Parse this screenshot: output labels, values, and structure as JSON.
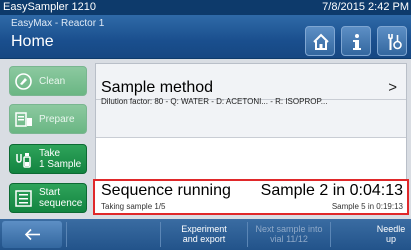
{
  "titlebar": {
    "app_name": "EasySampler 1210",
    "datetime": "7/8/2015 2:42 PM"
  },
  "header": {
    "subtitle": "EasyMax - Reactor 1",
    "title": "Home"
  },
  "icons": {
    "home": "home-icon",
    "info": "info-icon",
    "settings": "tool-icon"
  },
  "actions": [
    {
      "label": "Clean",
      "enabled": false,
      "icon": "clean-icon"
    },
    {
      "label": "Prepare",
      "enabled": false,
      "icon": "prepare-icon"
    },
    {
      "label_line1": "Take",
      "label_line2": "1 Sample",
      "enabled": true,
      "icon": "sample-vial-icon"
    },
    {
      "label_line1": "Start",
      "label_line2": "sequence",
      "enabled": true,
      "icon": "sequence-icon"
    }
  ],
  "method": {
    "title": "Sample method",
    "detail": "Dilution factor: 80 - Q: WATER - D: ACETONI... - R: ISOPROP...",
    "arrow": ">"
  },
  "sequence": {
    "title": "Sequence running",
    "status": "Taking sample 1/5",
    "next": "Sample 2 in 0:04:13",
    "next_sub": "Sample 5 in 0:19:13"
  },
  "bottom": {
    "back": "←",
    "experiment": [
      "Experiment",
      "and export"
    ],
    "next_sample": [
      "Next sample into",
      "vial 11/12"
    ],
    "needle": [
      "Needle",
      "up"
    ]
  },
  "colors": {
    "accent": "#1a4f8e",
    "green": "#128440",
    "alert_border": "#e0282a"
  }
}
